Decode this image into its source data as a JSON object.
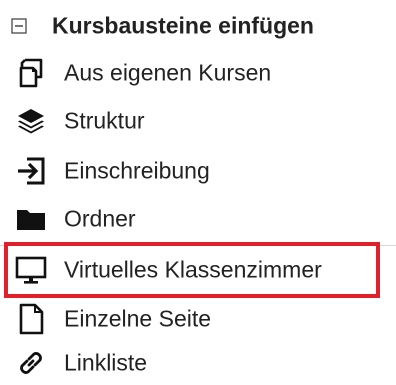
{
  "section": {
    "title": "Kursbausteine einfügen",
    "collapse_icon": "collapse-square-icon"
  },
  "items": [
    {
      "label": "Aus eigenen Kursen",
      "icon": "copy-course-icon"
    },
    {
      "label": "Struktur",
      "icon": "layers-icon"
    },
    {
      "label": "Einschreibung",
      "icon": "sign-in-icon"
    },
    {
      "label": "Ordner",
      "icon": "folder-icon"
    },
    {
      "label": "Virtuelles Klassenzimmer",
      "icon": "monitor-icon",
      "highlighted": true
    },
    {
      "label": "Einzelne Seite",
      "icon": "page-icon"
    },
    {
      "label": "Linkliste",
      "icon": "link-icon"
    }
  ],
  "colors": {
    "text": "#222222",
    "highlight_border": "#e0202a",
    "divider": "#d8d8d8"
  }
}
